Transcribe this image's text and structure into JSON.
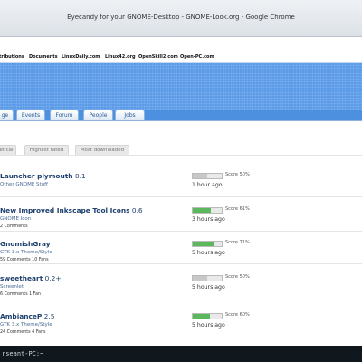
{
  "window": {
    "title": "Eyecandy for your GNOME-Desktop - GNOME-Look.org - Google Chrome"
  },
  "top_links": [
    "tributions",
    "Documents",
    "LinuxDaily.com",
    "Linux42.org",
    "OpenSkill2.com",
    "Open-PC.com"
  ],
  "nav_tabs": [
    "ge",
    "Events",
    "Forum",
    "People",
    "Jobs"
  ],
  "sort_tabs": [
    "etical",
    "Highest rated",
    "Most downloaded"
  ],
  "items": [
    {
      "name": "Launcher plymouth",
      "version": "0.1",
      "category": "Other GNOME Stuff",
      "meta": "",
      "score_label": "Score 50%",
      "score": 50,
      "time": "1 hour ago"
    },
    {
      "name": "New Improved Inkscape Tool Icons",
      "version": "0.6",
      "category": "GNOME Icon",
      "meta": "2 Comments",
      "score_label": "Score 61%",
      "score": 61,
      "time": "3 hours ago"
    },
    {
      "name": "GnomishGray",
      "version": "",
      "category": "GTK 3.x Theme/Style",
      "meta": "59 Comments   10 Fans",
      "score_label": "Score 71%",
      "score": 71,
      "time": "5 hours ago"
    },
    {
      "name": "sweetheart",
      "version": "0.2+",
      "category": "Screenlet",
      "meta": "6 Comments   1 Fan",
      "score_label": "Score 50%",
      "score": 50,
      "time": "5 hours ago"
    },
    {
      "name": "AmbianceP",
      "version": "2.5",
      "category": "GTK 3.x Theme/Style",
      "meta": "24 Comments   4 Fans",
      "score_label": "Score 60%",
      "score": 60,
      "time": "5 hours ago"
    }
  ],
  "taskbar": {
    "text": "rseant-PC:~"
  },
  "colors": {
    "banner": "#5c9be8",
    "score_fill": "#5cb85c",
    "score_fill_neutral": "#c8c8c8",
    "link": "#1d3f6e"
  }
}
